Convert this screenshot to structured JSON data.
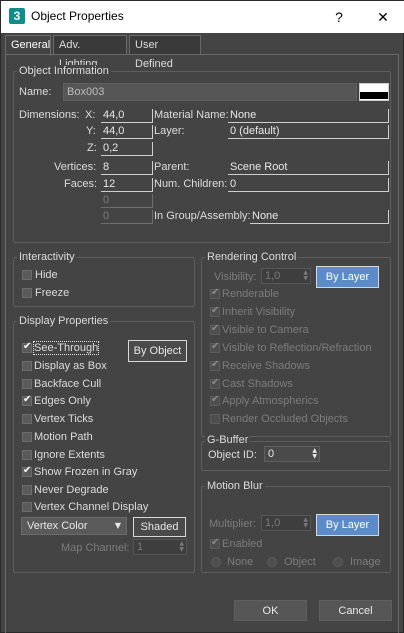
{
  "window": {
    "title": "Object Properties",
    "app_icon_text": "3",
    "minimize_glyph": "?",
    "close_glyph": "✕"
  },
  "tabs": [
    {
      "label": "General",
      "active": true
    },
    {
      "label": "Adv. Lighting",
      "active": false
    },
    {
      "label": "User Defined",
      "active": false
    }
  ],
  "object_info": {
    "title": "Object Information",
    "name_label": "Name:",
    "name_value": "Box003",
    "color_swatch": "#000000",
    "dimensions_label": "Dimensions:",
    "x_label": "X:",
    "x_value": "44,0",
    "y_label": "Y:",
    "y_value": "44,0",
    "z_label": "Z:",
    "z_value": "0,2",
    "vertices_label": "Vertices:",
    "vertices_value": "8",
    "faces_label": "Faces:",
    "faces_value": "12",
    "extra1_value": "0",
    "extra2_value": "0",
    "material_name_label": "Material Name:",
    "material_name_value": "None",
    "layer_label": "Layer:",
    "layer_value": "0 (default)",
    "parent_label": "Parent:",
    "parent_value": "Scene Root",
    "num_children_label": "Num. Children:",
    "num_children_value": "0",
    "group_label": "In Group/Assembly:",
    "group_value": "None"
  },
  "interactivity": {
    "title": "Interactivity",
    "hide_label": "Hide",
    "hide_checked": false,
    "freeze_label": "Freeze",
    "freeze_checked": false
  },
  "display_properties": {
    "title": "Display Properties",
    "by_object_label": "By Object",
    "items": [
      {
        "label": "See-Through",
        "checked": true
      },
      {
        "label": "Display as Box",
        "checked": false
      },
      {
        "label": "Backface Cull",
        "checked": false
      },
      {
        "label": "Edges Only",
        "checked": true
      },
      {
        "label": "Vertex Ticks",
        "checked": false
      },
      {
        "label": "Motion Path",
        "checked": false
      },
      {
        "label": "Ignore Extents",
        "checked": false
      },
      {
        "label": "Show Frozen in Gray",
        "checked": true
      },
      {
        "label": "Never Degrade",
        "checked": false
      },
      {
        "label": "Vertex Channel Display",
        "checked": false
      }
    ],
    "vertex_color_value": "Vertex Color",
    "shaded_label": "Shaded",
    "map_channel_label": "Map Channel:",
    "map_channel_value": "1"
  },
  "rendering_control": {
    "title": "Rendering Control",
    "visibility_label": "Visibility:",
    "visibility_value": "1,0",
    "by_layer_label": "By Layer",
    "items": [
      {
        "label": "Renderable",
        "checked": true
      },
      {
        "label": "Inherit Visibility",
        "checked": true
      },
      {
        "label": "Visible to Camera",
        "checked": true
      },
      {
        "label": "Visible to Reflection/Refraction",
        "checked": true
      },
      {
        "label": "Receive Shadows",
        "checked": true
      },
      {
        "label": "Cast Shadows",
        "checked": true
      },
      {
        "label": "Apply Atmospherics",
        "checked": true
      },
      {
        "label": "Render Occluded Objects",
        "checked": false
      }
    ]
  },
  "gbuffer": {
    "title": "G-Buffer",
    "object_id_label": "Object ID:",
    "object_id_value": "0"
  },
  "motion_blur": {
    "title": "Motion Blur",
    "multiplier_label": "Multiplier:",
    "multiplier_value": "1,0",
    "by_layer_label": "By Layer",
    "enabled_label": "Enabled",
    "enabled_checked": true,
    "radio_none": "None",
    "radio_object": "Object",
    "radio_image": "Image"
  },
  "footer": {
    "ok_label": "OK",
    "cancel_label": "Cancel"
  },
  "colors": {
    "background": "#444444",
    "accent_button": "#5b8bc8"
  }
}
